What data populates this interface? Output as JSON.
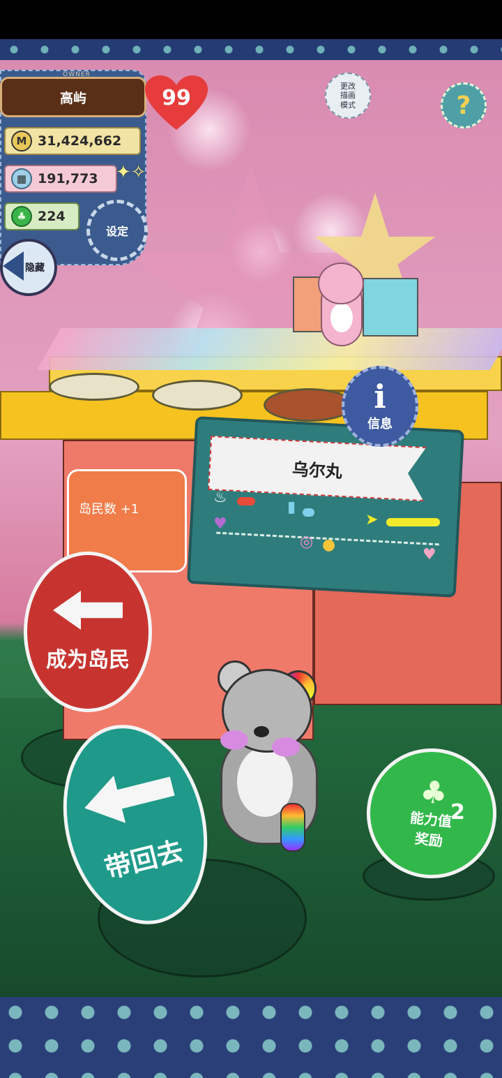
{
  "owner": {
    "caption": "OWNER",
    "name": "高屿",
    "level": "99",
    "coins": "31,424,662",
    "goods": "191,773",
    "clovers": "224"
  },
  "buttons": {
    "settings": "设定",
    "hide": "隐藏",
    "mode_line1": "更改",
    "mode_line2": "描画",
    "mode_line3": "模式",
    "help": "?",
    "info_icon": "i",
    "info": "信息"
  },
  "character": {
    "name": "乌尔丸",
    "chef_level": 0.15,
    "book_level": 0.1,
    "arrow_level": 0.45
  },
  "bubble": {
    "text": "岛民数 +1"
  },
  "signs": {
    "resident": "成为岛民",
    "take_back": "带回去",
    "reward_line1": "能力值",
    "reward_line2": "奖励",
    "reward_count": "2"
  },
  "icons": {
    "coin": "M",
    "clover": "♣"
  }
}
